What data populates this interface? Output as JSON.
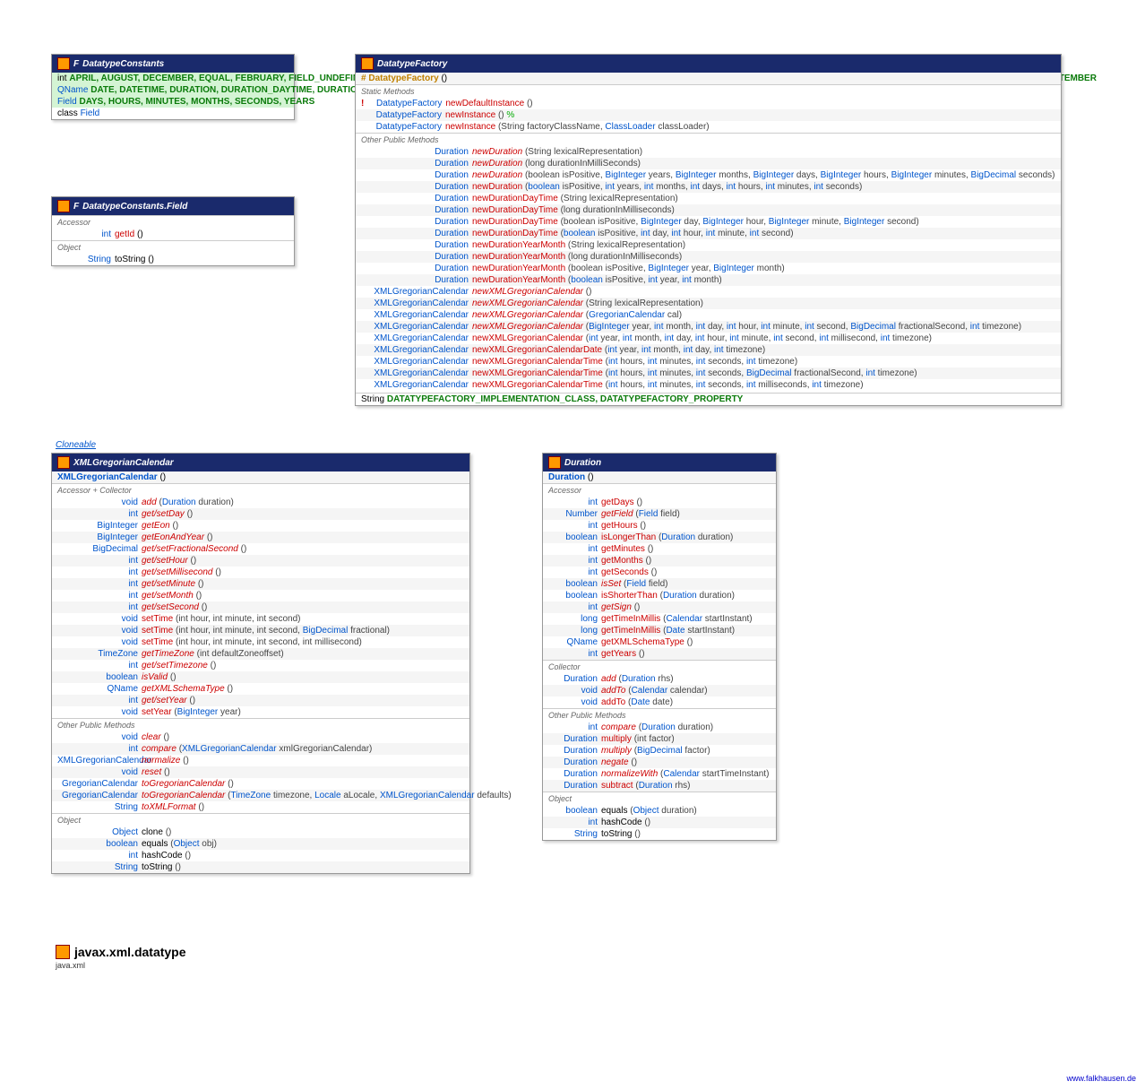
{
  "c1": {
    "title": "DatatypeConstants",
    "ints": "APRIL, AUGUST, DECEMBER, EQUAL, FEBRUARY, FIELD_UNDEFINED, GREATER, INDETERMINATE, JANUARY, JULY, JUNE, LESSER, MARCH, MAX_TIMEZONE_OFFSET, MAY, MIN_TIMEZONE_OFFSET, NOVEMBER, OCTOBER, SEPTEMBER",
    "qn": "DATE, DATETIME, DURATION, DURATION_DAYTIME, DURATION_YEARMONTH, GDAY, GMONTH, GMONTHDAY, GYEAR, GYEARMONTH, TIME",
    "fld": "DAYS, HOURS, MINUTES, MONTHS, SECONDS, YEARS",
    "cls": "Field"
  },
  "c2": {
    "title": "DatatypeConstants.Field",
    "s1": "Accessor",
    "m1t": "int",
    "m1": "getId",
    "s2": "Object",
    "m2t": "String",
    "m2": "toString"
  },
  "c3": {
    "title": "DatatypeFactory",
    "ctor": "DatatypeFactory",
    "s1": "Static Methods",
    "s2": "Other Public Methods",
    "r": [
      [
        "DatatypeFactory",
        "newDefaultInstance",
        "()",
        "!"
      ],
      [
        "DatatypeFactory",
        "newInstance",
        "() ",
        "",
        "%"
      ],
      [
        "DatatypeFactory",
        "newInstance",
        "(String factoryClassName, ",
        "ClassLoader",
        " classLoader) ",
        "%"
      ]
    ],
    "o": [
      [
        "Duration",
        "newDuration",
        "(String lexicalRepresentation)",
        1
      ],
      [
        "Duration",
        "newDuration",
        "(long durationInMilliSeconds)",
        1
      ],
      [
        "Duration",
        "newDuration",
        "(boolean isPositive, |BigInteger| years, |BigInteger| months, |BigInteger| days, |BigInteger| hours, |BigInteger| minutes, |BigDecimal| seconds)",
        1
      ],
      [
        "Duration",
        "newDuration",
        "(|boolean| isPositive, |int| years, |int| months, |int| days, |int| hours, |int| minutes, |int| seconds)",
        0
      ],
      [
        "Duration",
        "newDurationDayTime",
        "(String lexicalRepresentation)",
        0
      ],
      [
        "Duration",
        "newDurationDayTime",
        "(long durationInMilliseconds)",
        0
      ],
      [
        "Duration",
        "newDurationDayTime",
        "(boolean isPositive, |BigInteger| day, |BigInteger| hour, |BigInteger| minute, |BigInteger| second)",
        0
      ],
      [
        "Duration",
        "newDurationDayTime",
        "(|boolean| isPositive, |int| day, |int| hour, |int| minute, |int| second)",
        0
      ],
      [
        "Duration",
        "newDurationYearMonth",
        "(String lexicalRepresentation)",
        0
      ],
      [
        "Duration",
        "newDurationYearMonth",
        "(long durationInMilliseconds)",
        0
      ],
      [
        "Duration",
        "newDurationYearMonth",
        "(boolean isPositive, |BigInteger| year, |BigInteger| month)",
        0
      ],
      [
        "Duration",
        "newDurationYearMonth",
        "(|boolean| isPositive, |int| year, |int| month)",
        0
      ],
      [
        "XMLGregorianCalendar",
        "newXMLGregorianCalendar",
        "()",
        1
      ],
      [
        "XMLGregorianCalendar",
        "newXMLGregorianCalendar",
        "(String lexicalRepresentation)",
        1
      ],
      [
        "XMLGregorianCalendar",
        "newXMLGregorianCalendar",
        "(|GregorianCalendar| cal)",
        1
      ],
      [
        "XMLGregorianCalendar",
        "newXMLGregorianCalendar",
        "(|BigInteger| year, |int| month, |int| day, |int| hour, |int| minute, |int| second, |BigDecimal| fractionalSecond, |int| timezone)",
        1
      ],
      [
        "XMLGregorianCalendar",
        "newXMLGregorianCalendar",
        "(|int| year, |int| month, |int| day, |int| hour, |int| minute, |int| second, |int| millisecond, |int| timezone)",
        0
      ],
      [
        "XMLGregorianCalendar",
        "newXMLGregorianCalendarDate",
        "(|int| year, |int| month, |int| day, |int| timezone)",
        0
      ],
      [
        "XMLGregorianCalendar",
        "newXMLGregorianCalendarTime",
        "(|int| hours, |int| minutes, |int| seconds, |int| timezone)",
        0
      ],
      [
        "XMLGregorianCalendar",
        "newXMLGregorianCalendarTime",
        "(|int| hours, |int| minutes, |int| seconds, |BigDecimal| fractionalSecond, |int| timezone)",
        0
      ],
      [
        "XMLGregorianCalendar",
        "newXMLGregorianCalendarTime",
        "(|int| hours, |int| minutes, |int| seconds, |int| milliseconds, |int| timezone)",
        0
      ]
    ],
    "str": "DATATYPEFACTORY_IMPLEMENTATION_CLASS, DATATYPEFACTORY_PROPERTY"
  },
  "clone": "Cloneable",
  "c4": {
    "title": "XMLGregorianCalendar",
    "ctor": "XMLGregorianCalendar",
    "s1": "Accessor + Collector",
    "a": [
      [
        "void",
        "add",
        "(|Duration| duration)",
        1
      ],
      [
        "int",
        "get/setDay",
        "()",
        1
      ],
      [
        "BigInteger",
        "getEon",
        "()",
        1
      ],
      [
        "BigInteger",
        "getEonAndYear",
        "()",
        1
      ],
      [
        "BigDecimal",
        "get/setFractionalSecond",
        "()",
        1
      ],
      [
        "int",
        "get/setHour",
        "()",
        1
      ],
      [
        "int",
        "get/setMillisecond",
        "()",
        1
      ],
      [
        "int",
        "get/setMinute",
        "()",
        1
      ],
      [
        "int",
        "get/setMonth",
        "()",
        1
      ],
      [
        "int",
        "get/setSecond",
        "()",
        1
      ],
      [
        "void",
        "setTime",
        "(int hour, int minute, int second)",
        0
      ],
      [
        "void",
        "setTime",
        "(int hour, int minute, int second, |BigDecimal| fractional)",
        0
      ],
      [
        "void",
        "setTime",
        "(int hour, int minute, int second, int millisecond)",
        0
      ],
      [
        "TimeZone",
        "getTimeZone",
        "(int defaultZoneoffset)",
        1
      ],
      [
        "int",
        "get/setTimezone",
        "()",
        1
      ],
      [
        "boolean",
        "isValid",
        "()",
        1
      ],
      [
        "QName",
        "getXMLSchemaType",
        "()",
        1
      ],
      [
        "int",
        "get/setYear",
        "()",
        1
      ],
      [
        "void",
        "setYear",
        "(|BigInteger| year)",
        0
      ]
    ],
    "s2": "Other Public Methods",
    "o": [
      [
        "void",
        "clear",
        "()",
        1
      ],
      [
        "int",
        "compare",
        "(|XMLGregorianCalendar| xmlGregorianCalendar)",
        1
      ],
      [
        "XMLGregorianCalendar",
        "normalize",
        "()",
        1
      ],
      [
        "void",
        "reset",
        "()",
        1
      ],
      [
        "GregorianCalendar",
        "toGregorianCalendar",
        "()",
        1
      ],
      [
        "GregorianCalendar",
        "toGregorianCalendar",
        "(|TimeZone| timezone, |Locale| aLocale, |XMLGregorianCalendar| defaults)",
        1
      ],
      [
        "String",
        "toXMLFormat",
        "()",
        1
      ]
    ],
    "s3": "Object",
    "ob": [
      [
        "Object",
        "clone",
        "()"
      ],
      [
        "boolean",
        "equals",
        "(|Object| obj)"
      ],
      [
        "int",
        "hashCode",
        "()"
      ],
      [
        "String",
        "toString",
        "()"
      ]
    ]
  },
  "c5": {
    "title": "Duration",
    "ctor": "Duration",
    "s1": "Accessor",
    "a": [
      [
        "int",
        "getDays",
        "()",
        0
      ],
      [
        "Number",
        "getField",
        "(|Field| field)",
        1
      ],
      [
        "int",
        "getHours",
        "()",
        0
      ],
      [
        "boolean",
        "isLongerThan",
        "(|Duration| duration)",
        0
      ],
      [
        "int",
        "getMinutes",
        "()",
        0
      ],
      [
        "int",
        "getMonths",
        "()",
        0
      ],
      [
        "int",
        "getSeconds",
        "()",
        0
      ],
      [
        "boolean",
        "isSet",
        "(|Field| field)",
        1
      ],
      [
        "boolean",
        "isShorterThan",
        "(|Duration| duration)",
        0
      ],
      [
        "int",
        "getSign",
        "()",
        1
      ],
      [
        "long",
        "getTimeInMillis",
        "(|Calendar| startInstant)",
        0
      ],
      [
        "long",
        "getTimeInMillis",
        "(|Date| startInstant)",
        0
      ],
      [
        "QName",
        "getXMLSchemaType",
        "()",
        0
      ],
      [
        "int",
        "getYears",
        "()",
        0
      ]
    ],
    "s2": "Collector",
    "c": [
      [
        "Duration",
        "add",
        "(|Duration| rhs)",
        1
      ],
      [
        "void",
        "addTo",
        "(|Calendar| calendar)",
        1
      ],
      [
        "void",
        "addTo",
        "(|Date| date)",
        0
      ]
    ],
    "s3": "Other Public Methods",
    "o": [
      [
        "int",
        "compare",
        "(|Duration| duration)",
        1
      ],
      [
        "Duration",
        "multiply",
        "(int factor)",
        0
      ],
      [
        "Duration",
        "multiply",
        "(|BigDecimal| factor)",
        1
      ],
      [
        "Duration",
        "negate",
        "()",
        1
      ],
      [
        "Duration",
        "normalizeWith",
        "(|Calendar| startTimeInstant)",
        1
      ],
      [
        "Duration",
        "subtract",
        "(|Duration| rhs)",
        0
      ]
    ],
    "s4": "Object",
    "ob": [
      [
        "boolean",
        "equals",
        "(|Object| duration)"
      ],
      [
        "int",
        "hashCode",
        "()"
      ],
      [
        "String",
        "toString",
        "()"
      ]
    ]
  },
  "pkg": "javax.xml.datatype",
  "sub": "java.xml",
  "brand": "www.falkhausen.de"
}
